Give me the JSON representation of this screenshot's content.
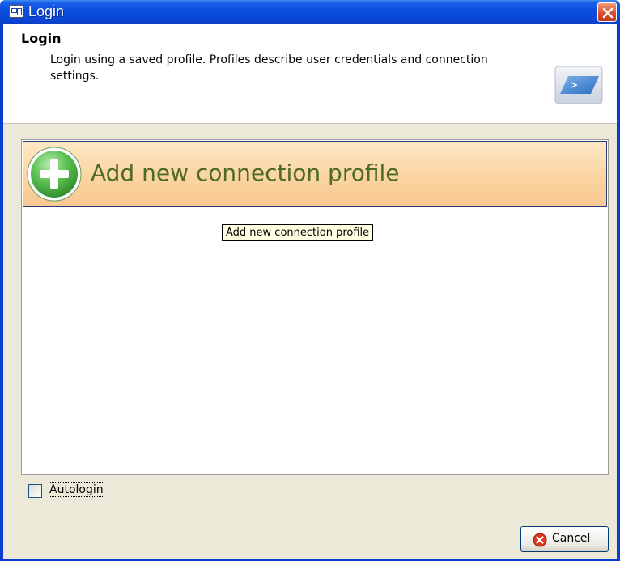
{
  "window": {
    "title": "Login"
  },
  "header": {
    "title": "Login",
    "description": "Login using a saved profile. Profiles describe user credentials and connection settings.",
    "graphic_icon": "connection-graphic-icon"
  },
  "profiles": {
    "add_label": "Add new connection profile",
    "add_icon": "add-plus-icon",
    "tooltip": "Add new connection profile"
  },
  "options": {
    "autologin_label": "Autologin",
    "autologin_checked": false
  },
  "footer": {
    "cancel_label": "Cancel",
    "cancel_icon": "cancel-x-icon"
  },
  "colors": {
    "titlebar": "#0b48d6",
    "client_bg": "#ece9d8",
    "profile_row": "#fbd4a0",
    "profile_text": "#4d6a2a",
    "add_icon_green": "#3fa63a",
    "close_red": "#d9512b"
  }
}
